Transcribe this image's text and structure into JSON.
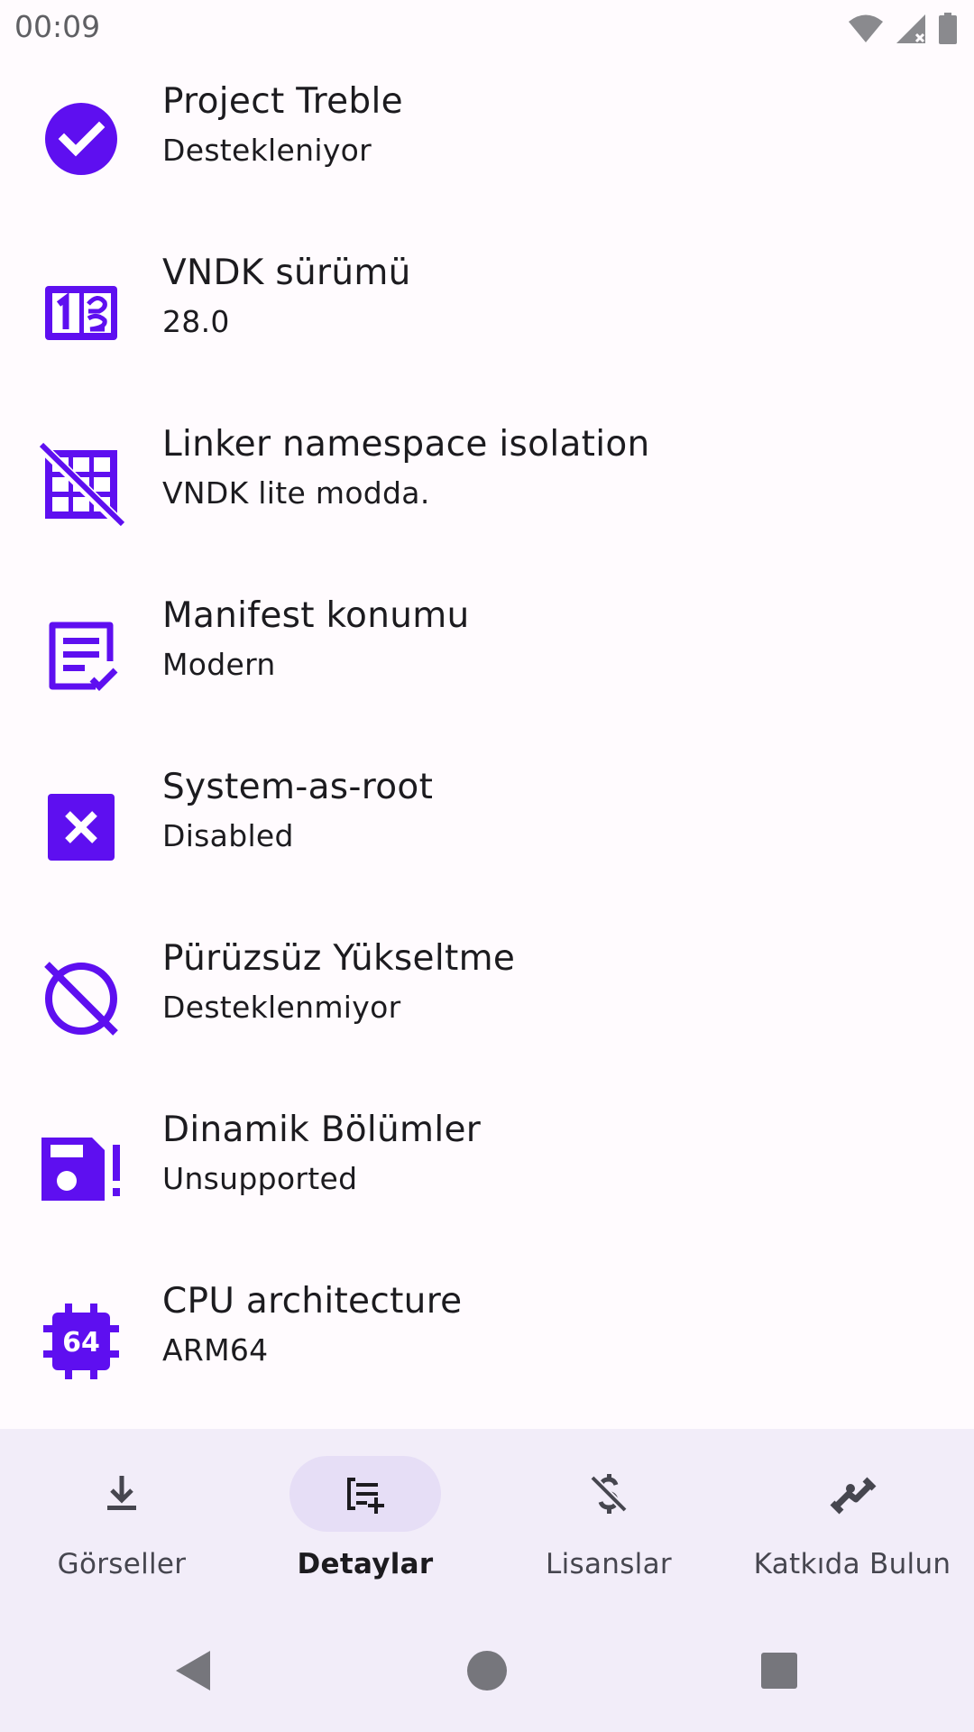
{
  "status_bar": {
    "time": "00:09",
    "icons": [
      "wifi-icon",
      "cell-signal-icon",
      "battery-icon"
    ]
  },
  "colors": {
    "accent": "#5e0ff0",
    "background": "#fffbfe",
    "nav_background": "#f2edf9",
    "nav_active_pill": "#e6def6",
    "text_primary": "#1c1b1f",
    "text_secondary": "#46464f"
  },
  "details": [
    {
      "icon": "check-circle-icon",
      "title": "Project Treble",
      "subtitle": "Destekleniyor"
    },
    {
      "icon": "numbers-icon",
      "title": "VNDK sürümü",
      "subtitle": "28.0"
    },
    {
      "icon": "grid-off-icon",
      "title": "Linker namespace isolation",
      "subtitle": "VNDK lite modda."
    },
    {
      "icon": "manifest-icon",
      "title": "Manifest konumu",
      "subtitle": "Modern"
    },
    {
      "icon": "close-box-icon",
      "title": "System-as-root",
      "subtitle": "Disabled"
    },
    {
      "icon": "blocked-icon",
      "title": "Pürüzsüz Yükseltme",
      "subtitle": "Desteklenmiyor"
    },
    {
      "icon": "save-alert-icon",
      "title": "Dinamik Bölümler",
      "subtitle": "Unsupported"
    },
    {
      "icon": "cpu-64-icon",
      "title": "CPU architecture",
      "subtitle": "ARM64"
    }
  ],
  "bottom_nav": [
    {
      "icon": "download-icon",
      "label": "Görseller",
      "active": false
    },
    {
      "icon": "playlist-add-icon",
      "label": "Detaylar",
      "active": true
    },
    {
      "icon": "money-off-icon",
      "label": "Lisanslar",
      "active": false
    },
    {
      "icon": "handshake-icon",
      "label": "Katkıda Bulun",
      "active": false
    }
  ],
  "system_nav": [
    "back-icon",
    "home-icon",
    "recents-icon"
  ]
}
